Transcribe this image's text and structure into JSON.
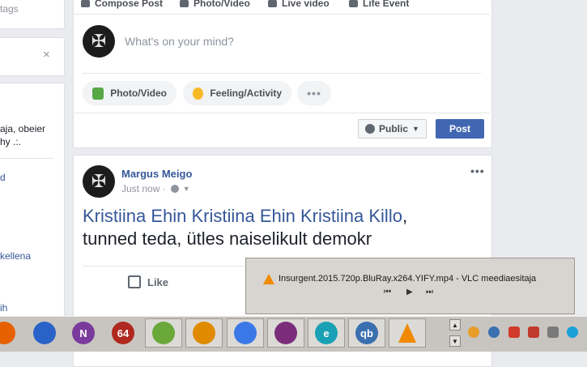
{
  "left": {
    "tags_label": "tags",
    "close_glyph": "×",
    "text_line1": "aja, obeier",
    "text_line2": "hy .:.",
    "link_d": "d",
    "link_kellena": "kellena",
    "link_ih": "ih"
  },
  "composer": {
    "tabs": [
      "Compose Post",
      "Photo/Video",
      "Live video",
      "Life Event"
    ],
    "placeholder": "What's on your mind?",
    "actions": [
      "Photo/Video",
      "Feeling/Activity"
    ],
    "more_glyph": "•••",
    "privacy_label": "Public",
    "post_label": "Post"
  },
  "post": {
    "author": "Margus Meigo",
    "timestamp": "Just now ·",
    "more_glyph": "•••",
    "text_link": "Kristiina Ehin Kristiina Ehin Kristiina Killo",
    "text_rest": ", tunned teda, ütles naiselikult demokr",
    "like_label": "Like"
  },
  "vlc_preview": {
    "title": "Insurgent.2015.720p.BluRay.x264.YIFY.mp4 - VLC meediaesitaja",
    "prev_glyph": "⏮",
    "play_glyph": "▶",
    "next_glyph": "⏭"
  },
  "taskbar": {
    "apps": [
      {
        "name": "firefox-icon",
        "color": "#e66000"
      },
      {
        "name": "media-player-icon",
        "color": "#2a63c8"
      },
      {
        "name": "onenote-icon",
        "color": "#7a3b9d",
        "glyph": "N"
      },
      {
        "name": "aida64-icon",
        "color": "#b0281e",
        "glyph": "64"
      },
      {
        "name": "notepad-plus-icon",
        "color": "#6aa83a"
      },
      {
        "name": "search-tool-icon",
        "color": "#e08a00"
      },
      {
        "name": "chrome-icon",
        "color": "#3b78e7"
      },
      {
        "name": "winrar-icon",
        "color": "#7b2d7b"
      },
      {
        "name": "eset-icon",
        "color": "#1aa0b5",
        "glyph": "e"
      },
      {
        "name": "qbittorrent-icon",
        "color": "#3a6fb0",
        "glyph": "qb"
      },
      {
        "name": "vlc-icon",
        "color": "#f08a00"
      }
    ],
    "scroll_up": "▲",
    "scroll_down": "▼"
  }
}
